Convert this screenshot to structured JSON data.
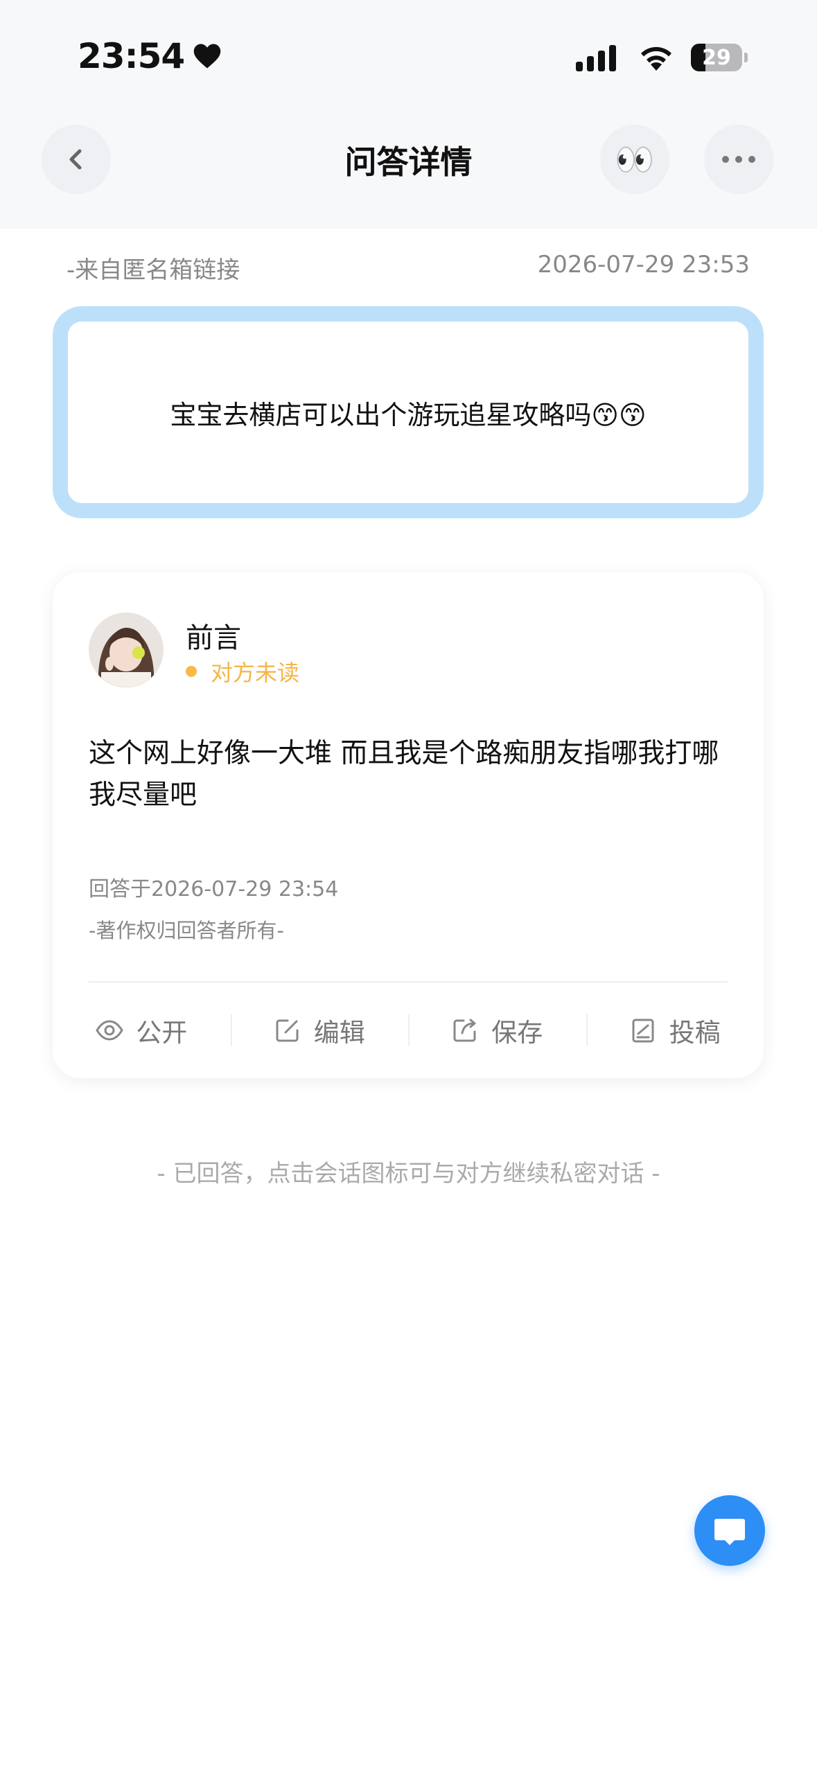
{
  "status_bar": {
    "time": "23:54",
    "battery": "29",
    "battery_fraction": 0.29
  },
  "nav": {
    "title": "问答详情",
    "eyes_emoji": "👀"
  },
  "question": {
    "source": "-来自匿名箱链接",
    "time": "2026-07-29 23:53",
    "text": "宝宝去横店可以出个游玩追星攻略吗😙😙"
  },
  "answer": {
    "author": "前言",
    "read_status": "对方未读",
    "text": "这个网上好像一大堆 而且我是个路痴朋友指哪我打哪 我尽量吧",
    "time": "回答于2026-07-29 23:54",
    "copyright": "-著作权归回答者所有-",
    "actions": [
      {
        "label": "公开",
        "icon": "eye-icon"
      },
      {
        "label": "编辑",
        "icon": "edit-icon"
      },
      {
        "label": "保存",
        "icon": "share-icon"
      },
      {
        "label": "投稿",
        "icon": "document-icon"
      }
    ]
  },
  "hint": "- 已回答，点击会话图标可与对方继续私密对话 -",
  "colors": {
    "accent": "#2d8ef5",
    "question_border": "#bde0fa",
    "unread": "#f5b547"
  }
}
